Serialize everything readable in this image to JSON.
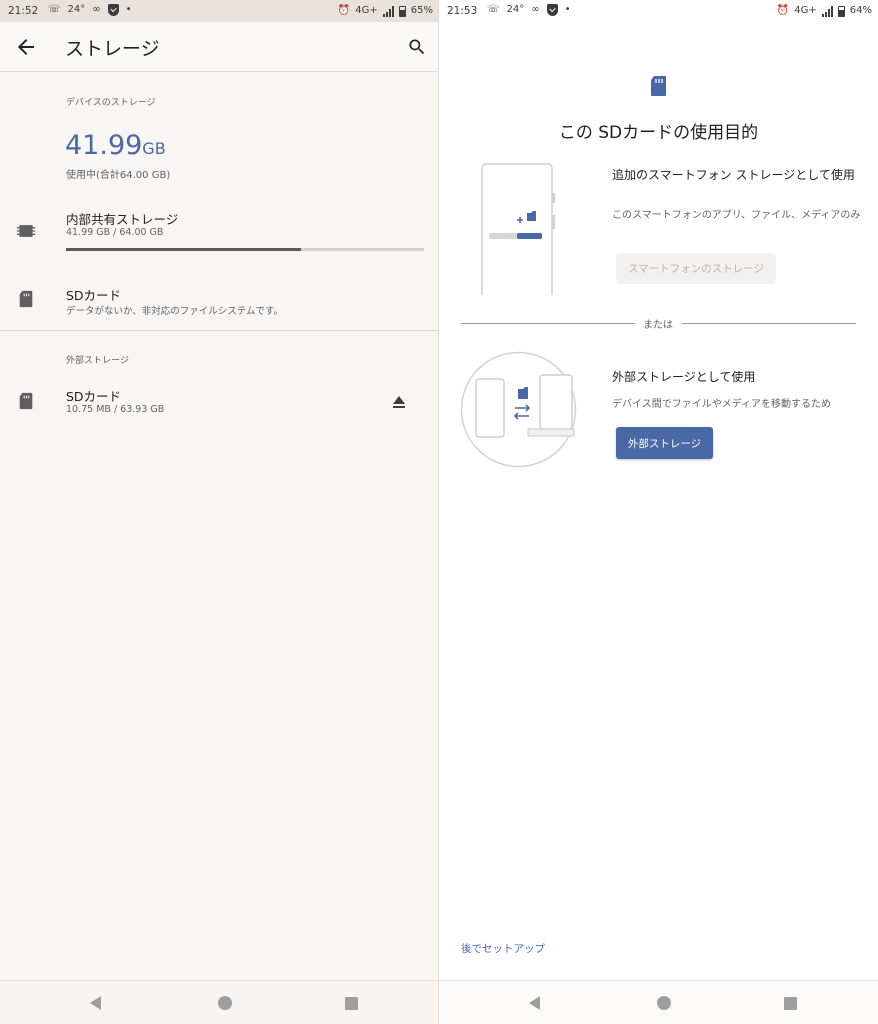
{
  "left": {
    "status": {
      "time": "21:52",
      "temp": "24°",
      "network": "4G+",
      "battery": "65%"
    },
    "appbar": {
      "title": "ストレージ"
    },
    "device_section_label": "デバイスのストレージ",
    "usage": {
      "value": "41.99",
      "unit": "GB",
      "subtitle": "使用中(合計64.00 GB)"
    },
    "internal": {
      "title": "内部共有ストレージ",
      "subtitle": "41.99 GB / 64.00 GB",
      "used_fraction": 0.656
    },
    "sd_card_internal": {
      "title": "SDカード",
      "subtitle": "データがないか、非対応のファイルシステムです。"
    },
    "external_section_label": "外部ストレージ",
    "sd_card_external": {
      "title": "SDカード",
      "subtitle": "10.75 MB / 63.93 GB"
    }
  },
  "right": {
    "status": {
      "time": "21:53",
      "temp": "24°",
      "network": "4G+",
      "battery": "64%"
    },
    "title": "この SDカードの使用目的",
    "option_phone": {
      "title": "追加のスマートフォン ストレージとして使用",
      "description": "このスマートフォンのアプリ、ファイル、メディアのみ",
      "button": "スマートフォンのストレージ"
    },
    "or_text": "または",
    "option_portable": {
      "title": "外部ストレージとして使用",
      "description": "デバイス間でファイルやメディアを移動するため",
      "button": "外部ストレージ"
    },
    "later_link": "後でセットアップ"
  },
  "colors": {
    "accent": "#4a68a6",
    "left_background": "#f8f5f2",
    "right_background": "#ffffff"
  }
}
